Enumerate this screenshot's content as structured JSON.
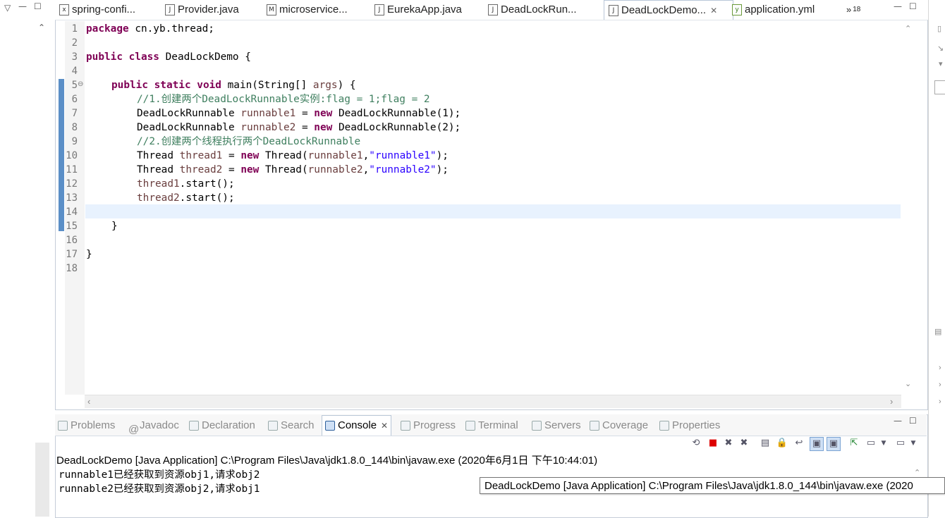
{
  "editor_tabs": [
    {
      "label": "spring-confi...",
      "icon": "x"
    },
    {
      "label": "Provider.java",
      "icon": "J"
    },
    {
      "label": "microservice...",
      "icon": "M"
    },
    {
      "label": "EurekaApp.java",
      "icon": "J"
    },
    {
      "label": "DeadLockRun...",
      "icon": "J"
    },
    {
      "label": "DeadLockDemo...",
      "icon": "J",
      "active": true
    },
    {
      "label": "application.yml",
      "icon": "y"
    }
  ],
  "overflow_count": "18",
  "code_lines": [
    "1",
    "2",
    "3",
    "4",
    "5",
    "6",
    "7",
    "8",
    "9",
    "10",
    "11",
    "12",
    "13",
    "14",
    "15",
    "16",
    "17",
    "18"
  ],
  "code": {
    "l1_kw": "package",
    "l1_rest": " cn.yb.thread;",
    "l3_kw": "public class",
    "l3_rest": " DeadLockDemo {",
    "l5_kw": "public static void",
    "l5_a": " main(String[] ",
    "l5_var": "args",
    "l5_b": ") {",
    "l6_cm": "//1.创建两个DeadLockRunnable实例:flag = 1;flag = 2",
    "l7_a": "DeadLockRunnable ",
    "l7_var": "runnable1",
    "l7_b": " = ",
    "l7_kw": "new",
    "l7_c": " DeadLockRunnable(1);",
    "l8_a": "DeadLockRunnable ",
    "l8_var": "runnable2",
    "l8_b": " = ",
    "l8_kw": "new",
    "l8_c": " DeadLockRunnable(2);",
    "l9_cm": "//2.创建两个线程执行两个DeadLockRunnable",
    "l10_a": "Thread ",
    "l10_var": "thread1",
    "l10_b": " = ",
    "l10_kw": "new",
    "l10_c": " Thread(",
    "l10_var2": "runnable1",
    "l10_d": ",",
    "l10_st": "\"runnable1\"",
    "l10_e": ");",
    "l11_a": "Thread ",
    "l11_var": "thread2",
    "l11_b": " = ",
    "l11_kw": "new",
    "l11_c": " Thread(",
    "l11_var2": "runnable2",
    "l11_d": ",",
    "l11_st": "\"runnable2\"",
    "l11_e": ");",
    "l12_var": "thread1",
    "l12_rest": ".start();",
    "l13_var": "thread2",
    "l13_rest": ".start();",
    "l15": "}",
    "l17": "}"
  },
  "panel_tabs": [
    {
      "label": "Problems"
    },
    {
      "label": "Javadoc"
    },
    {
      "label": "Declaration"
    },
    {
      "label": "Search"
    },
    {
      "label": "Console",
      "active": true
    },
    {
      "label": "Progress"
    },
    {
      "label": "Terminal"
    },
    {
      "label": "Servers"
    },
    {
      "label": "Coverage"
    },
    {
      "label": "Properties"
    }
  ],
  "console": {
    "title": "DeadLockDemo [Java Application] C:\\Program Files\\Java\\jdk1.8.0_144\\bin\\javaw.exe (2020年6月1日 下午10:44:01)",
    "lines": [
      "runnable1已经获取到资源obj1,请求obj2",
      "runnable2已经获取到资源obj2,请求obj1"
    ],
    "tooltip": "DeadLockDemo [Java Application] C:\\Program Files\\Java\\jdk1.8.0_144\\bin\\javaw.exe (2020"
  },
  "colors": {
    "keyword": "#7f0055",
    "comment": "#3f7f5f",
    "string": "#2a00ff",
    "local_variable": "#6a3e3e",
    "current_line": "#e8f2fe"
  }
}
